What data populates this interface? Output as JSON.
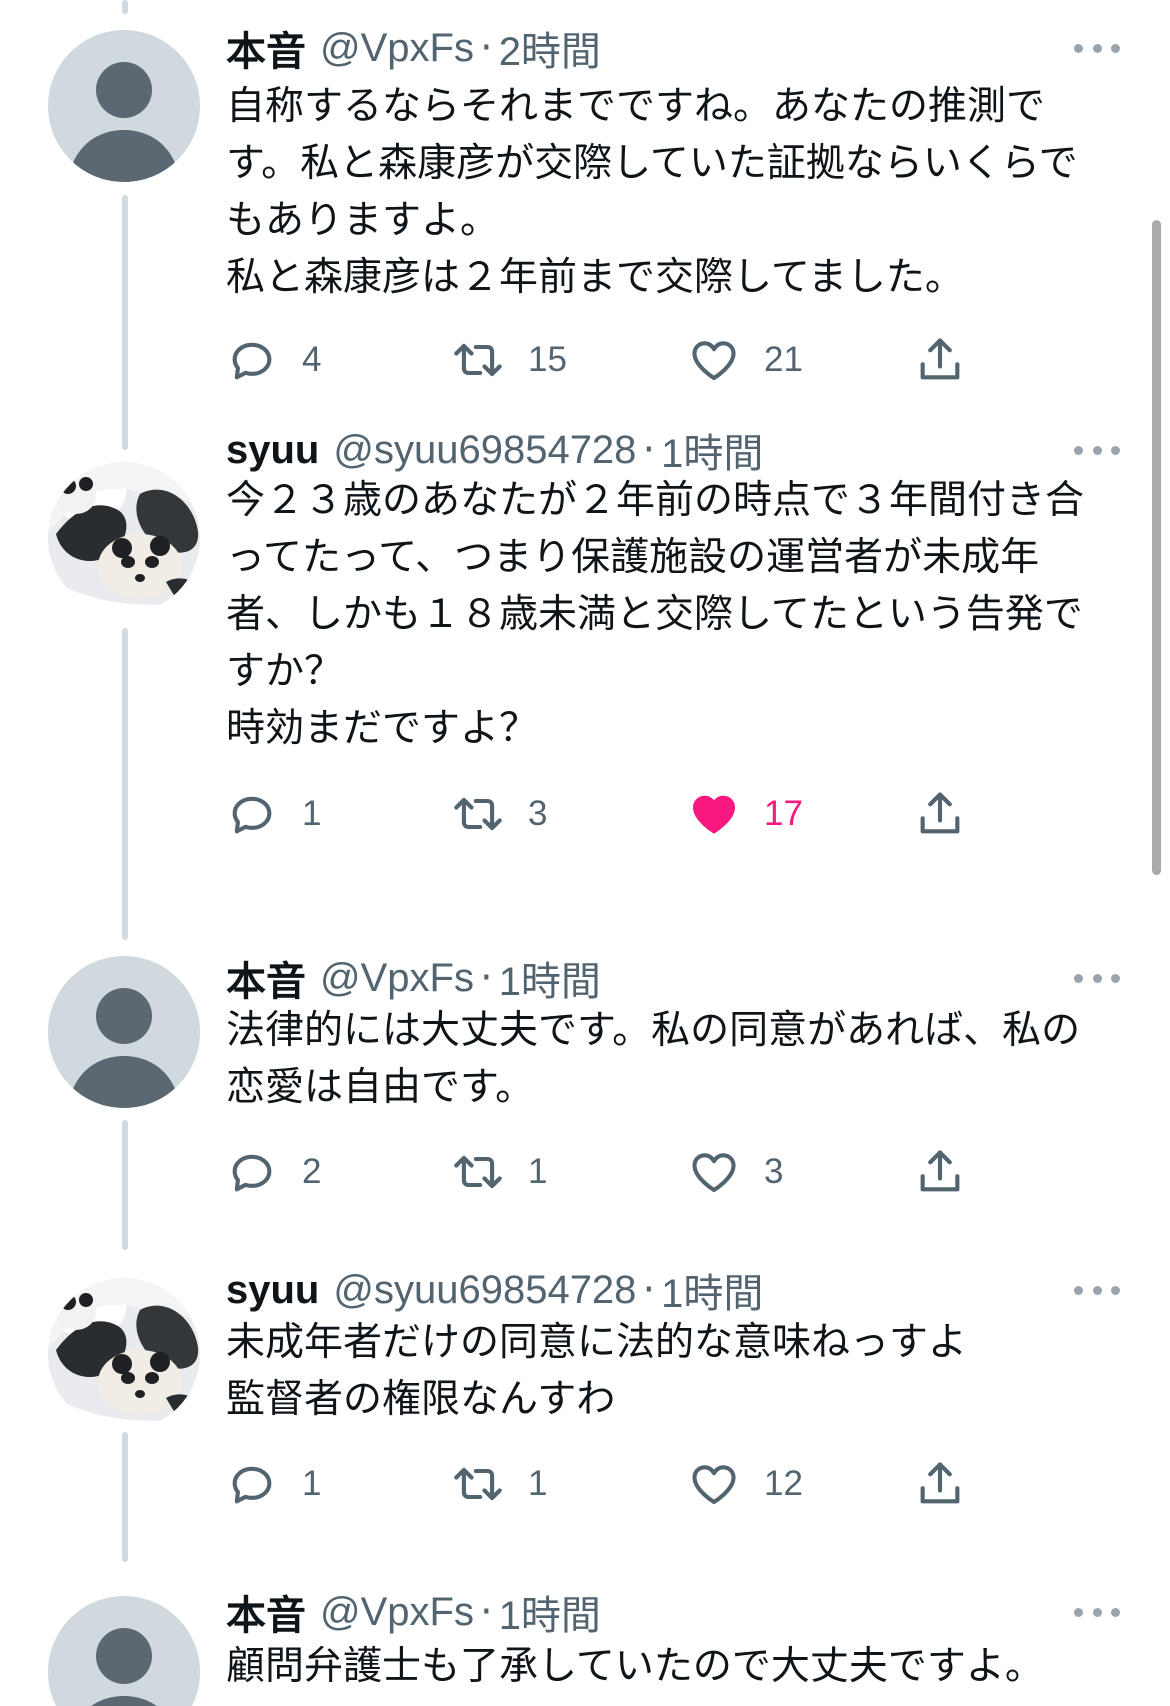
{
  "tweets": [
    {
      "name": "本音",
      "handle": "@VpxFs",
      "separator": "·",
      "time": "2時間",
      "text": "自称するならそれまでですね。あなたの推測です。私と森康彦が交際していた証拠ならいくらでもありますよ。\n私と森康彦は２年前まで交際してました。",
      "avatar": "default-avatar-icon",
      "replies": "4",
      "retweets": "15",
      "likes": "21",
      "liked": false
    },
    {
      "name": "syuu",
      "handle": "@syuu69854728",
      "separator": "·",
      "time": "1時間",
      "text": "今２３歳のあなたが２年前の時点で３年間付き合ってたって、つまり保護施設の運営者が未成年者、しかも１８歳未満と交際してたという告発ですか？\n時効まだですよ？",
      "avatar": "panda-avatar-icon",
      "replies": "1",
      "retweets": "3",
      "likes": "17",
      "liked": true
    },
    {
      "name": "本音",
      "handle": "@VpxFs",
      "separator": "·",
      "time": "1時間",
      "text": "法律的には大丈夫です。私の同意があれば、私の恋愛は自由です。",
      "avatar": "default-avatar-icon",
      "replies": "2",
      "retweets": "1",
      "likes": "3",
      "liked": false
    },
    {
      "name": "syuu",
      "handle": "@syuu69854728",
      "separator": "·",
      "time": "1時間",
      "text": "未成年者だけの同意に法的な意味ねっすよ\n監督者の権限なんすわ",
      "avatar": "panda-avatar-icon",
      "replies": "1",
      "retweets": "1",
      "likes": "12",
      "liked": false
    },
    {
      "name": "本音",
      "handle": "@VpxFs",
      "separator": "·",
      "time": "1時間",
      "text": "顧問弁護士も了承していたので大丈夫ですよ。",
      "avatar": "default-avatar-icon"
    }
  ],
  "colors": {
    "text": "#0f1419",
    "secondary": "#536471",
    "like_active": "#f91880",
    "thread_line": "#cfd9de",
    "avatar_bg": "#cfd9de",
    "avatar_fg": "#5b6771"
  },
  "icons": [
    "more-icon",
    "reply-icon",
    "retweet-icon",
    "like-icon",
    "share-icon"
  ]
}
